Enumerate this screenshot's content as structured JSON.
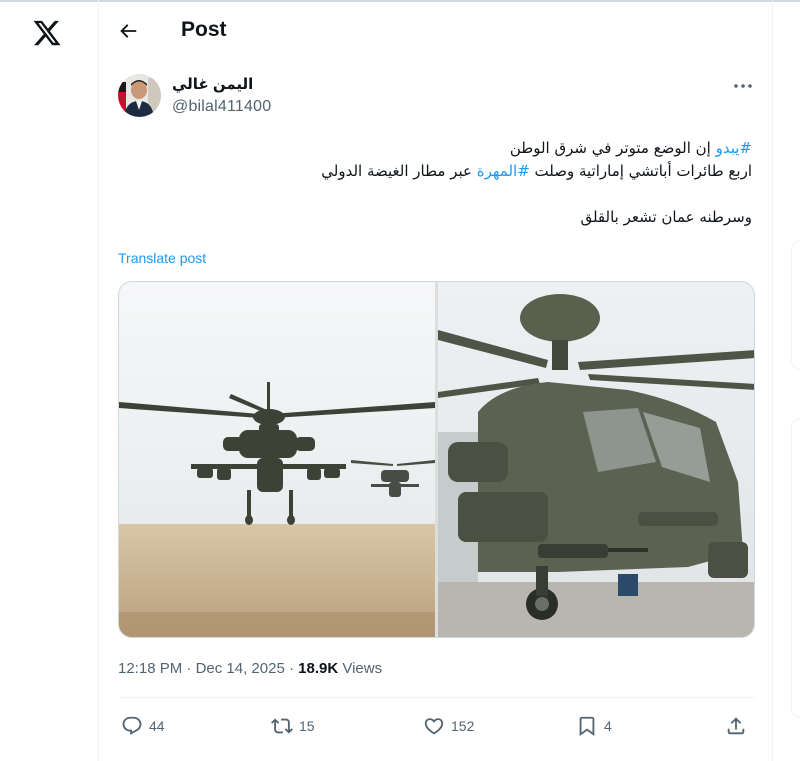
{
  "header": {
    "title": "Post",
    "back_icon": "arrow-left-icon",
    "logo_icon": "x-logo-icon"
  },
  "author": {
    "display_name": "اليمن غالي",
    "handle": "@bilal411400",
    "more_icon": "more-horizontal-icon"
  },
  "tweet": {
    "line1_hashtag": "#يبدو",
    "line1_text": " إن الوضع متوتر في شرق الوطن",
    "line2_text_a": "اربع طائرات أباتشي إماراتية وصلت ",
    "line2_hashtag": "#المهرة",
    "line2_text_b": " عبر مطار الغيضة الدولي",
    "line3_text": "وسرطنه عمان تشعر بالقلق",
    "translate_label": "Translate post"
  },
  "meta": {
    "time": "12:18 PM",
    "separator": " · ",
    "date": "Dec 14, 2025",
    "separator2": " · ",
    "views": "18.9K",
    "views_label": " Views"
  },
  "actions": {
    "replies": "44",
    "reposts": "15",
    "likes": "152",
    "bookmarks": "4"
  },
  "colors": {
    "accent": "#1d9bf0",
    "text_primary": "#0f1419",
    "text_secondary": "#536471",
    "border": "#eff3f4"
  }
}
